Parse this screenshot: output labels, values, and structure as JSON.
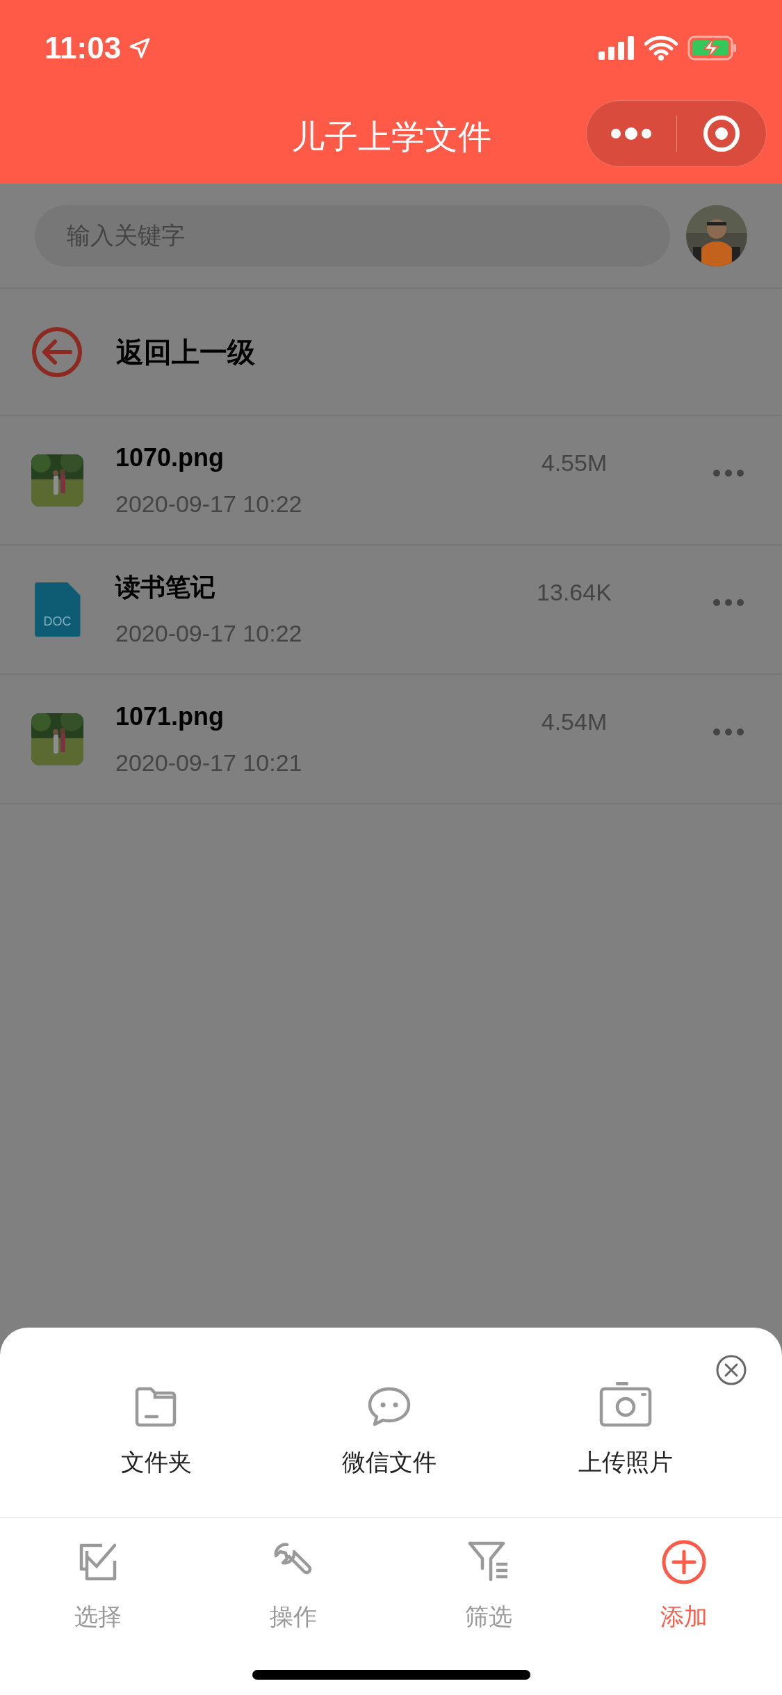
{
  "status_bar": {
    "time": "11:03"
  },
  "nav": {
    "title": "儿子上学文件"
  },
  "search": {
    "placeholder": "输入关键字"
  },
  "back": {
    "label": "返回上一级"
  },
  "files": [
    {
      "name": "1070.png",
      "date": "2020-09-17 10:22",
      "size": "4.55M"
    },
    {
      "kind": "doc",
      "badge": "DOC",
      "name": "读书笔记",
      "date": "2020-09-17 10:22",
      "size": "13.64K"
    },
    {
      "name": "1071.png",
      "date": "2020-09-17 10:21",
      "size": "4.54M"
    }
  ],
  "sheet": {
    "options": [
      {
        "kind": "folder",
        "label": "文件夹"
      },
      {
        "kind": "chat",
        "label": "微信文件"
      },
      {
        "kind": "camera",
        "label": "上传照片"
      }
    ]
  },
  "tabs": [
    {
      "kind": "select",
      "label": "选择",
      "selected": false
    },
    {
      "kind": "tools",
      "label": "操作",
      "selected": false
    },
    {
      "kind": "filter",
      "label": "筛选",
      "selected": false
    },
    {
      "kind": "add",
      "label": "添加",
      "selected": true
    }
  ]
}
